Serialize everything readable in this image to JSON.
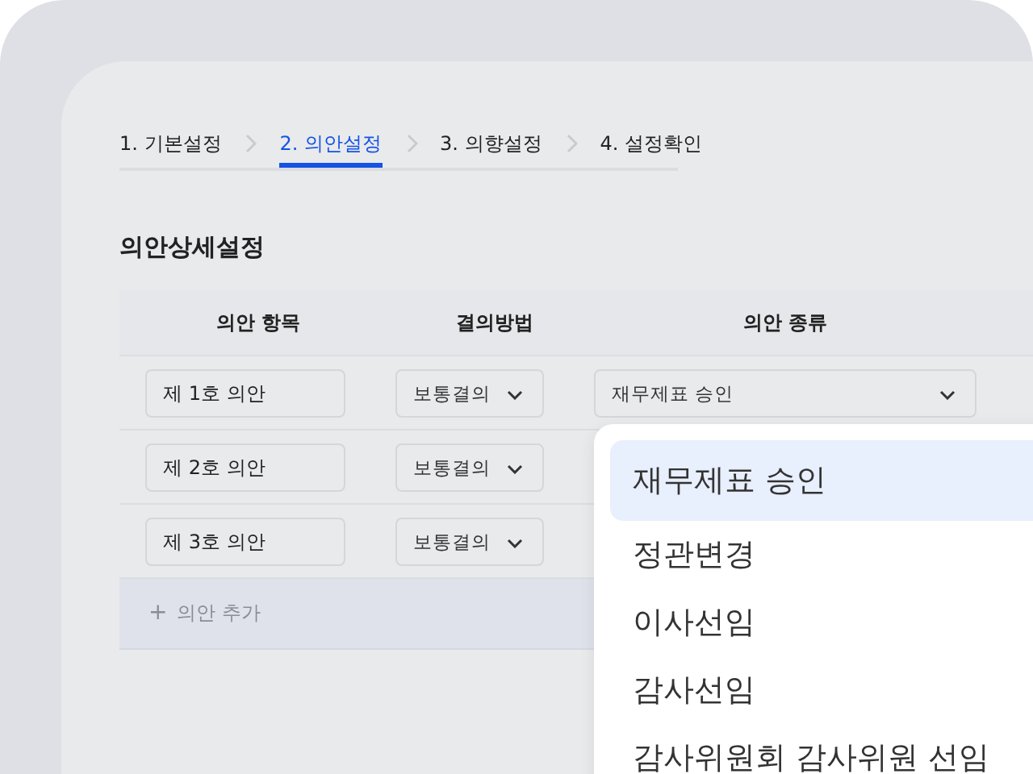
{
  "steps": [
    {
      "label": "1. 기본설정",
      "selected": false
    },
    {
      "label": "2. 의안설정",
      "selected": true
    },
    {
      "label": "3. 의향설정",
      "selected": false
    },
    {
      "label": "4. 설정확인",
      "selected": false
    }
  ],
  "section_title": "의안상세설정",
  "table": {
    "columns": [
      "의안 항목",
      "결의방법",
      "의안 종류"
    ],
    "rows": [
      {
        "item": "제 1호 의안",
        "method": "보통결의",
        "type": "재무제표 승인"
      },
      {
        "item": "제 2호 의안",
        "method": "보통결의"
      },
      {
        "item": "제 3호 의안",
        "method": "보통결의"
      }
    ],
    "add_row": {
      "icon": "+",
      "label": "의안 추가"
    }
  },
  "dropdown": {
    "options": [
      {
        "label": "재무제표 승인",
        "selected": true
      },
      {
        "label": "정관변경",
        "selected": false
      },
      {
        "label": "이사선임",
        "selected": false
      },
      {
        "label": "감사선임",
        "selected": false
      },
      {
        "label": "감사위원회 감사위원 선임",
        "selected": false
      }
    ]
  }
}
